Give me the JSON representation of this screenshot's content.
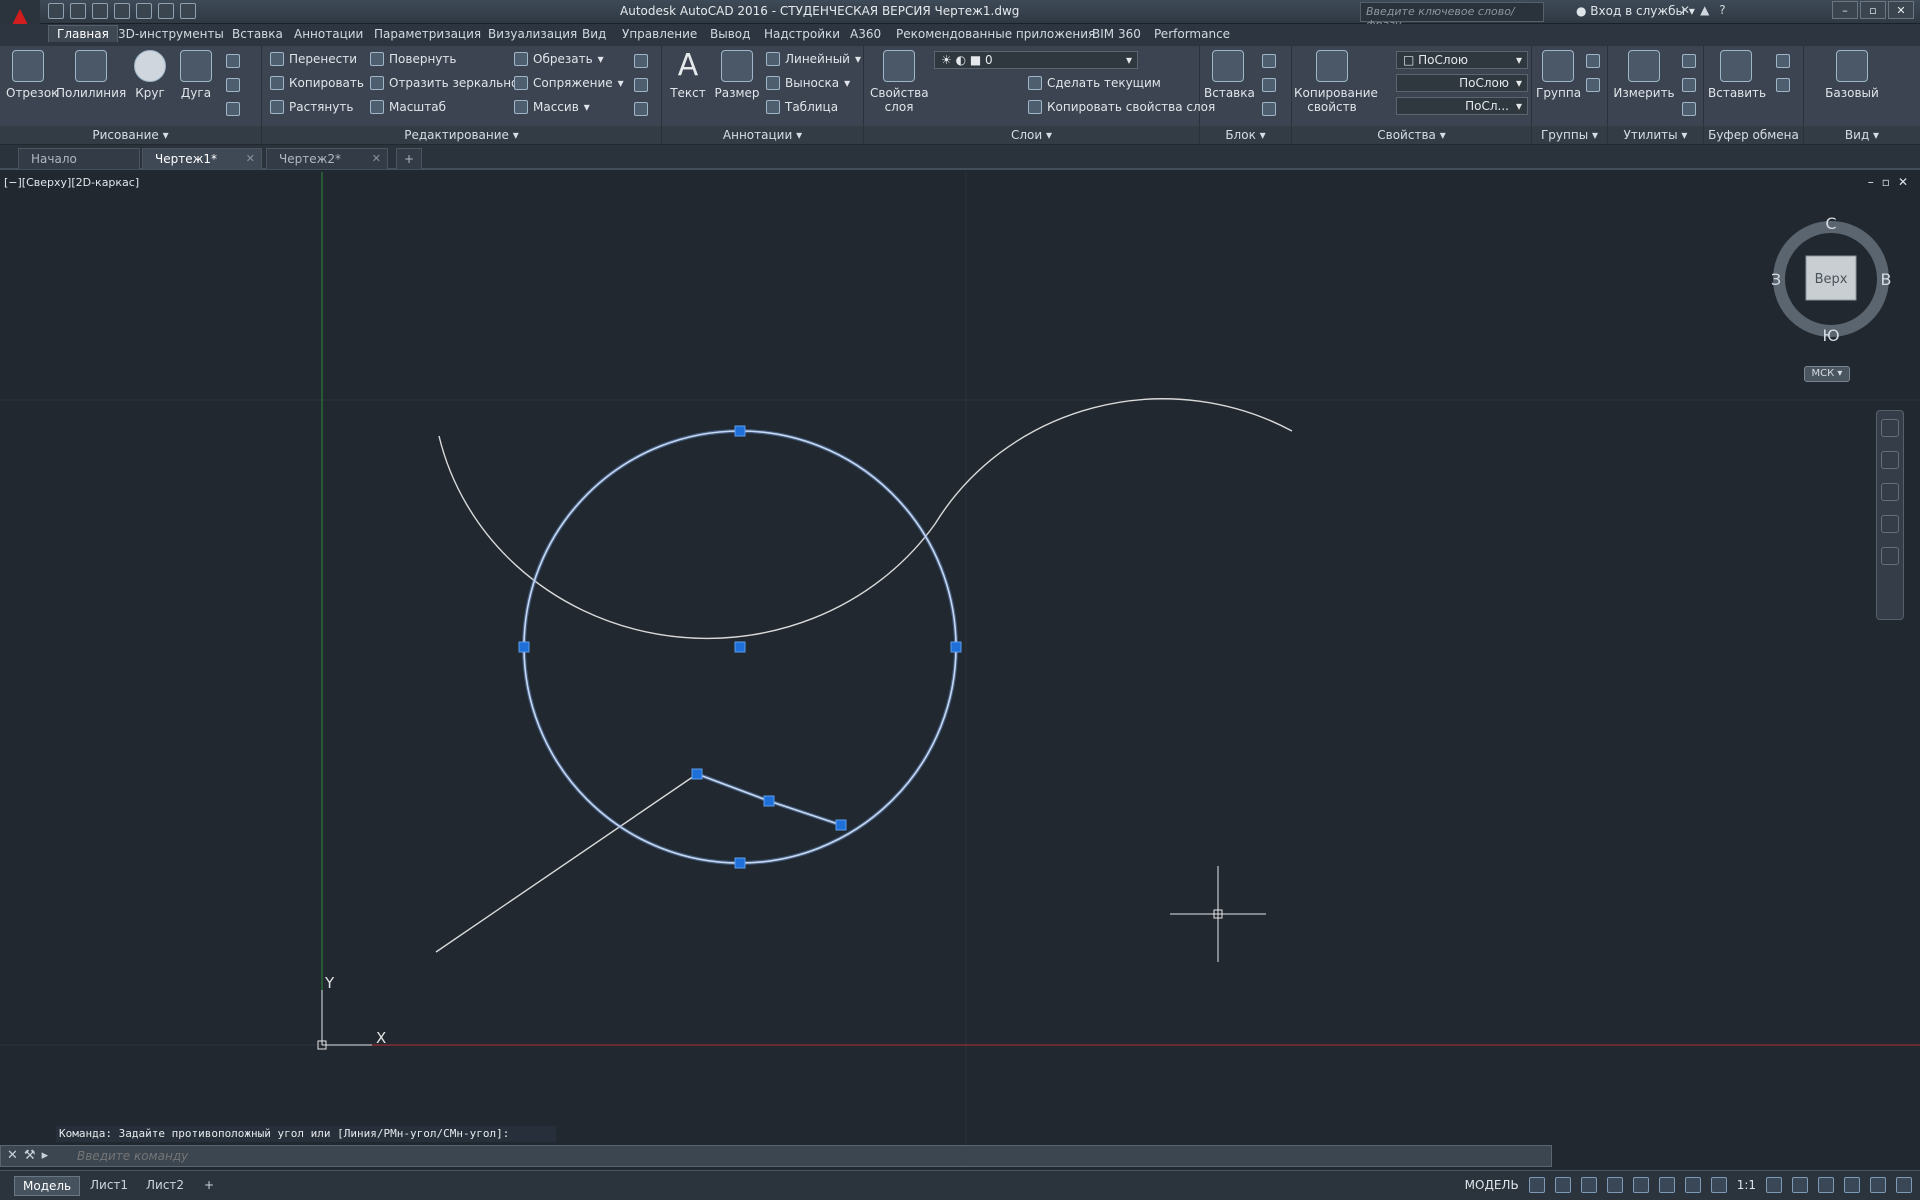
{
  "title": "Autodesk AutoCAD 2016 - СТУДЕНЧЕСКАЯ ВЕРСИЯ    Чертеж1.dwg",
  "search": {
    "placeholder": "Введите ключевое слово/фразу"
  },
  "signin": "Вход в службы",
  "ribbon_tabs": [
    "Главная",
    "3D-инструменты",
    "Вставка",
    "Аннотации",
    "Параметризация",
    "Визуализация",
    "Вид",
    "Управление",
    "Вывод",
    "Надстройки",
    "A360",
    "Рекомендованные приложения",
    "BIM 360",
    "Performance"
  ],
  "panels": {
    "draw": {
      "label": "Рисование",
      "line": "Отрезок",
      "polyline": "Полилиния",
      "circle": "Круг",
      "arc": "Дуга"
    },
    "modify": {
      "label": "Редактирование",
      "move": "Перенести",
      "copy": "Копировать",
      "stretch": "Растянуть",
      "rotate": "Повернуть",
      "mirror": "Отразить зеркально",
      "scale": "Масштаб",
      "trim": "Обрезать",
      "fillet": "Сопряжение",
      "array": "Массив"
    },
    "annotation": {
      "label": "Аннотации",
      "text": "Текст",
      "dimension": "Размер",
      "linear": "Линейный",
      "leader": "Выноска",
      "table": "Таблица"
    },
    "layers": {
      "label": "Слои",
      "layer_props_1": "Свойства",
      "layer_props_2": "слоя",
      "layer_value": "0",
      "make_current": "Сделать текущим",
      "match_layer": "Копировать свойства слоя"
    },
    "block": {
      "label": "Блок",
      "insert": "Вставка"
    },
    "properties": {
      "label": "Свойства",
      "match_1": "Копирование",
      "match_2": "свойств",
      "color": "ПоСлою",
      "linetype": "ПоСлою",
      "lineweight": "ПоСл..."
    },
    "groups": {
      "label": "Группы",
      "group": "Группа"
    },
    "utilities": {
      "label": "Утилиты",
      "measure": "Измерить"
    },
    "clipboard": {
      "label": "Буфер обмена",
      "paste": "Вставить"
    },
    "view": {
      "label": "Вид",
      "base": "Базовый"
    }
  },
  "file_tabs": [
    {
      "label": "Начало"
    },
    {
      "label": "Чертеж1*"
    },
    {
      "label": "Чертеж2*"
    }
  ],
  "viewport_label": "[−][Сверху][2D-каркас]",
  "viewcube": {
    "north": "С",
    "south": "Ю",
    "east": "В",
    "west": "З",
    "face": "Верх",
    "ucs": "МСК"
  },
  "ucs_axes": {
    "x": "X",
    "y": "Y"
  },
  "command": {
    "history": "Команда: Задайте противоположный угол или [Линия/РМн-угол/СМн-угол]:",
    "placeholder": "Введите команду"
  },
  "layout_tabs": [
    "Модель",
    "Лист1",
    "Лист2"
  ],
  "status": {
    "model": "МОДЕЛЬ",
    "scale": "1:1"
  },
  "colors": {
    "background": "#212830",
    "selection": "#6f9be0",
    "grip": "#1e6fd8",
    "geometry": "#d9d9d9",
    "x_axis": "#b33030",
    "y_axis": "#2f8a3a"
  }
}
